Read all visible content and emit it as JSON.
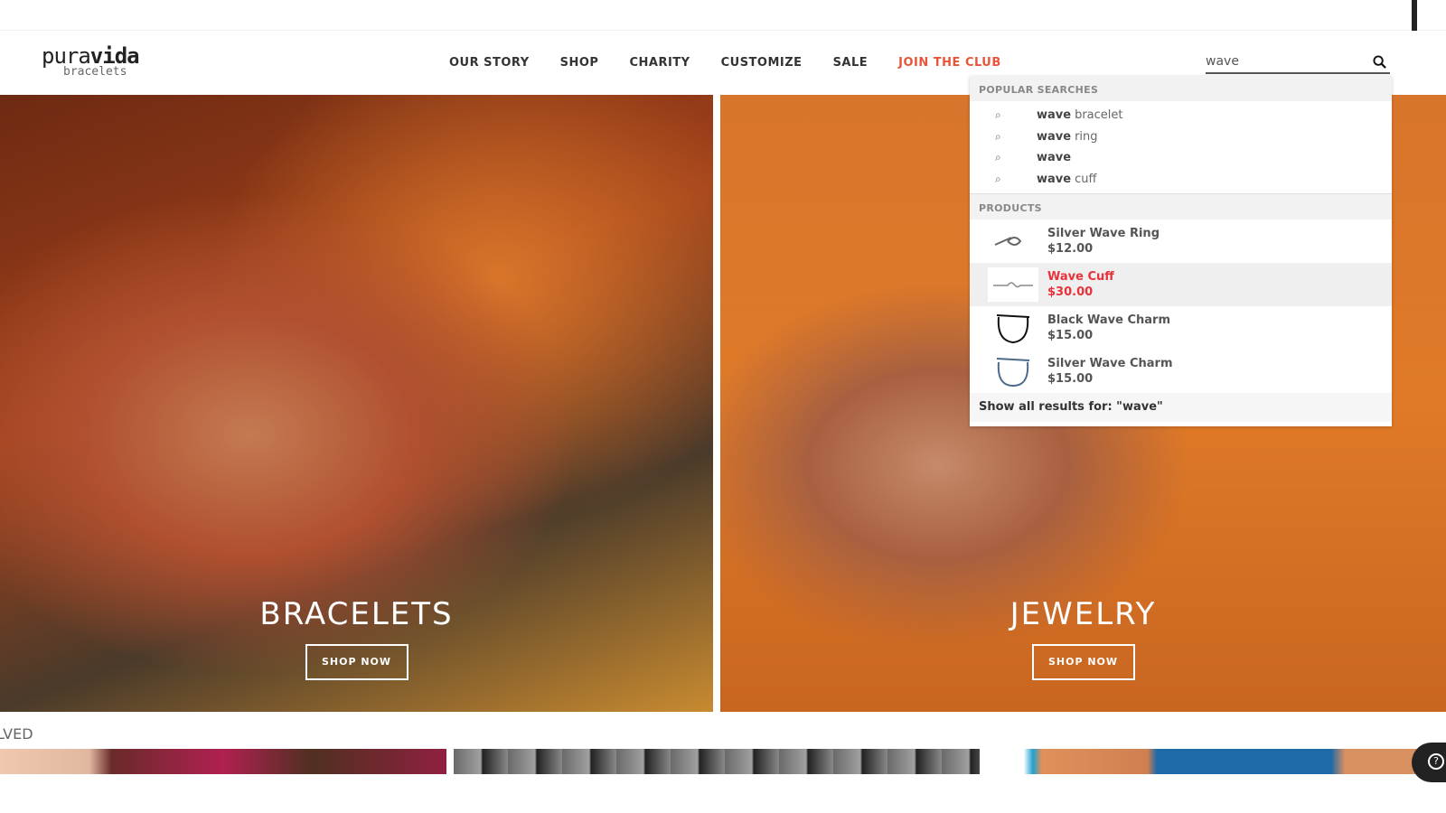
{
  "logo": {
    "line1a": "pura",
    "line1b": "vida",
    "line2": "bracelets"
  },
  "nav": [
    {
      "label": "OUR STORY"
    },
    {
      "label": "SHOP"
    },
    {
      "label": "CHARITY"
    },
    {
      "label": "CUSTOMIZE"
    },
    {
      "label": "SALE"
    },
    {
      "label": "JOIN THE CLUB",
      "color": "#e8553a"
    }
  ],
  "search": {
    "value": "wave",
    "icon": "search-icon"
  },
  "dropdown": {
    "popular_title": "POPULAR SEARCHES",
    "popular": [
      {
        "bold": "wave",
        "rest": "bracelet"
      },
      {
        "bold": "wave",
        "rest": "ring"
      },
      {
        "bold": "wave",
        "rest": ""
      },
      {
        "bold": "wave",
        "rest": "cuff"
      }
    ],
    "products_title": "PRODUCTS",
    "products": [
      {
        "name": "Silver Wave Ring",
        "price": "$12.00"
      },
      {
        "name": "Wave Cuff",
        "price": "$30.00",
        "highlighted": true
      },
      {
        "name": "Black Wave Charm",
        "price": "$15.00"
      },
      {
        "name": "Silver Wave Charm",
        "price": "$15.00"
      }
    ],
    "show_all": "Show all results for: \"wave\"",
    "highlight_color": "#e8323c"
  },
  "heroes": [
    {
      "title": "BRACELETS",
      "button": "SHOP NOW"
    },
    {
      "title": "JEWELRY",
      "button": "SHOP NOW"
    }
  ],
  "section_partial": "LVED",
  "help": {
    "icon": "help-icon",
    "label": "?"
  }
}
